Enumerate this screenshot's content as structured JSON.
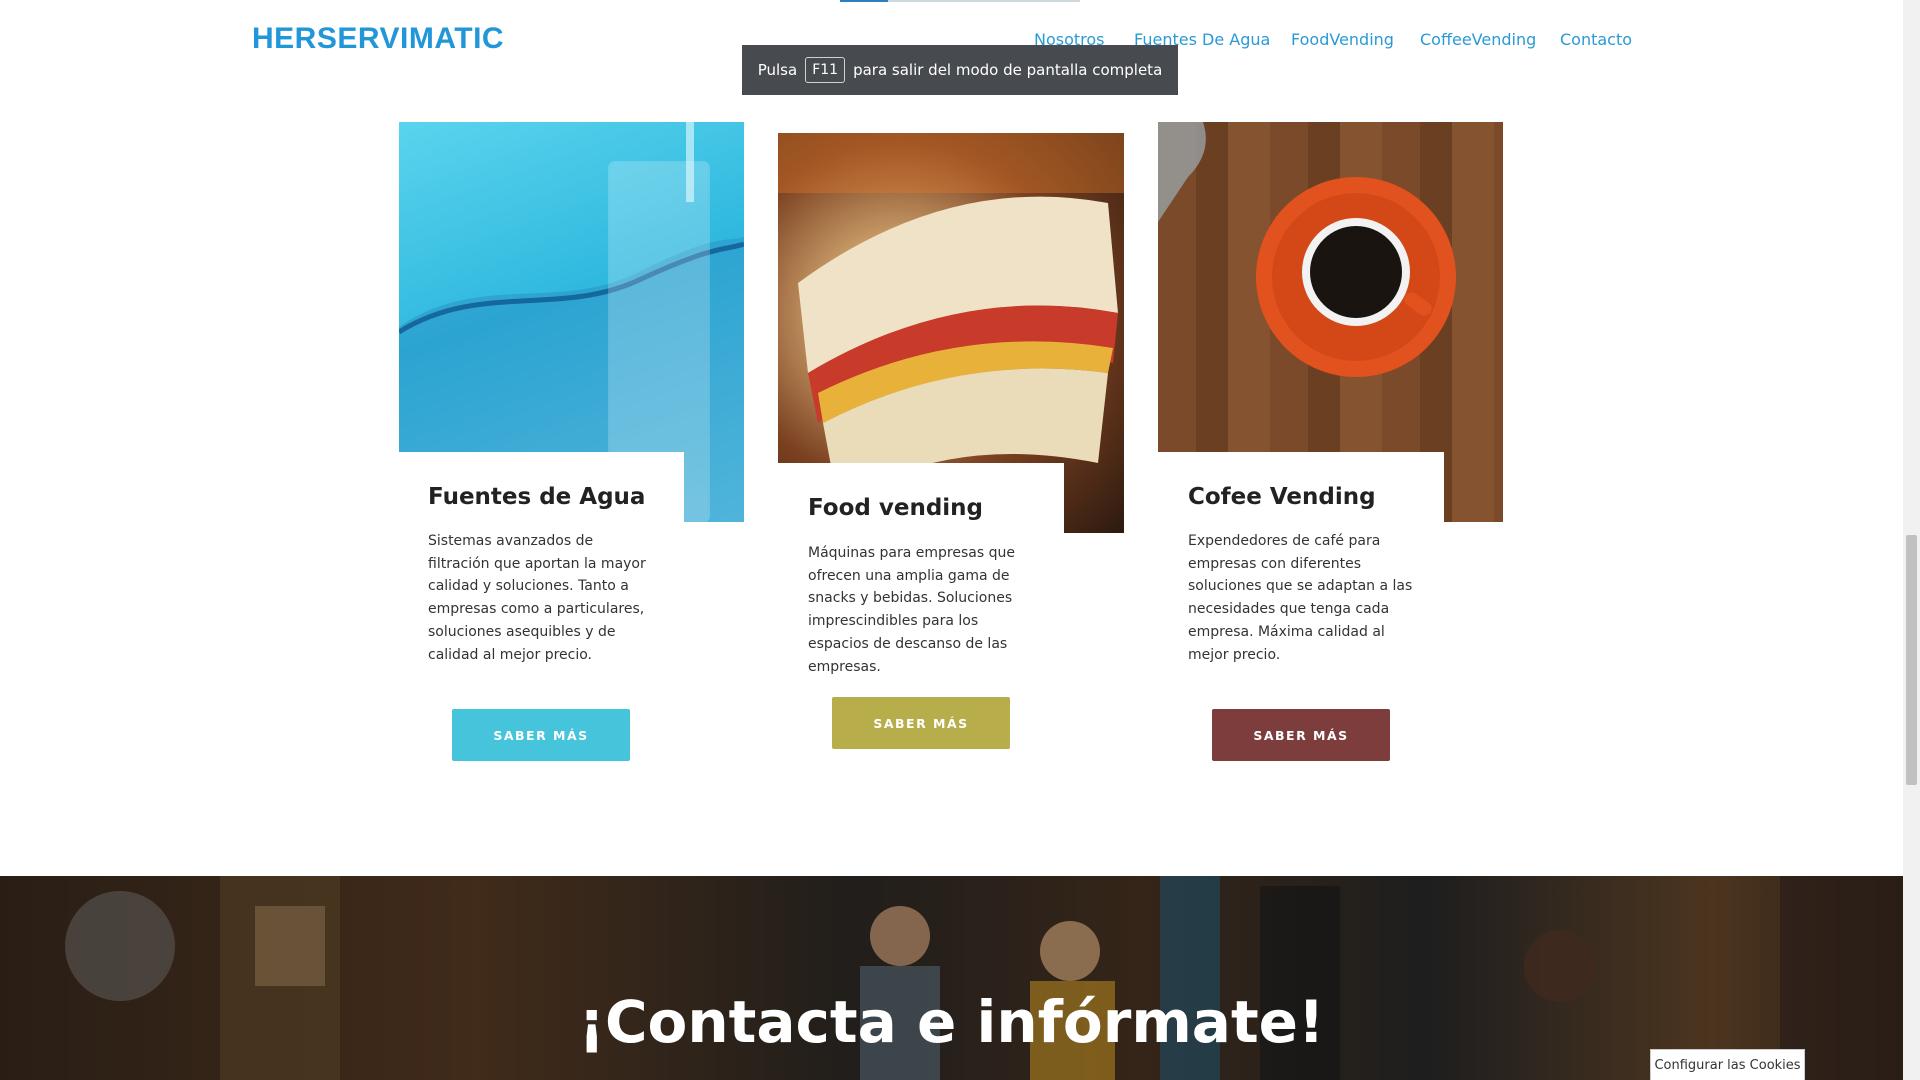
{
  "header": {
    "logo": "HERSERVIMATIC",
    "nav": [
      {
        "label": "Nosotros"
      },
      {
        "label": "Fuentes  De Agua"
      },
      {
        "label": "FoodVending"
      },
      {
        "label": "CoffeeVending"
      },
      {
        "label": "Contacto"
      }
    ]
  },
  "toast": {
    "prefix": "Pulsa",
    "key": "F11",
    "suffix": "para salir del modo de pantalla completa"
  },
  "cards": [
    {
      "title": "Fuentes de Agua",
      "text": "Sistemas avanzados de filtración que aportan la mayor calidad y soluciones. Tanto a empresas como a particulares, soluciones asequibles y de calidad al mejor precio.",
      "button": "SABER MÁS",
      "color": "#45c4dc"
    },
    {
      "title": "Food vending",
      "text": "Máquinas para empresas que ofrecen una amplia gama de snacks y bebidas. Soluciones imprescindibles para los espacios de descanso de las empresas.",
      "button": "SABER MÁS",
      "color": "#b7ad4a"
    },
    {
      "title": "Cofee Vending",
      "text": "Expendedores de café para empresas con diferentes soluciones que se adaptan a las necesidades que tenga cada empresa. Máxima calidad al mejor precio.",
      "button": "SABER MÁS",
      "color": "#7d3d3c"
    }
  ],
  "banner": {
    "title": "¡Contacta e infórmate!"
  },
  "cookie": {
    "label": "Configurar las Cookies"
  }
}
